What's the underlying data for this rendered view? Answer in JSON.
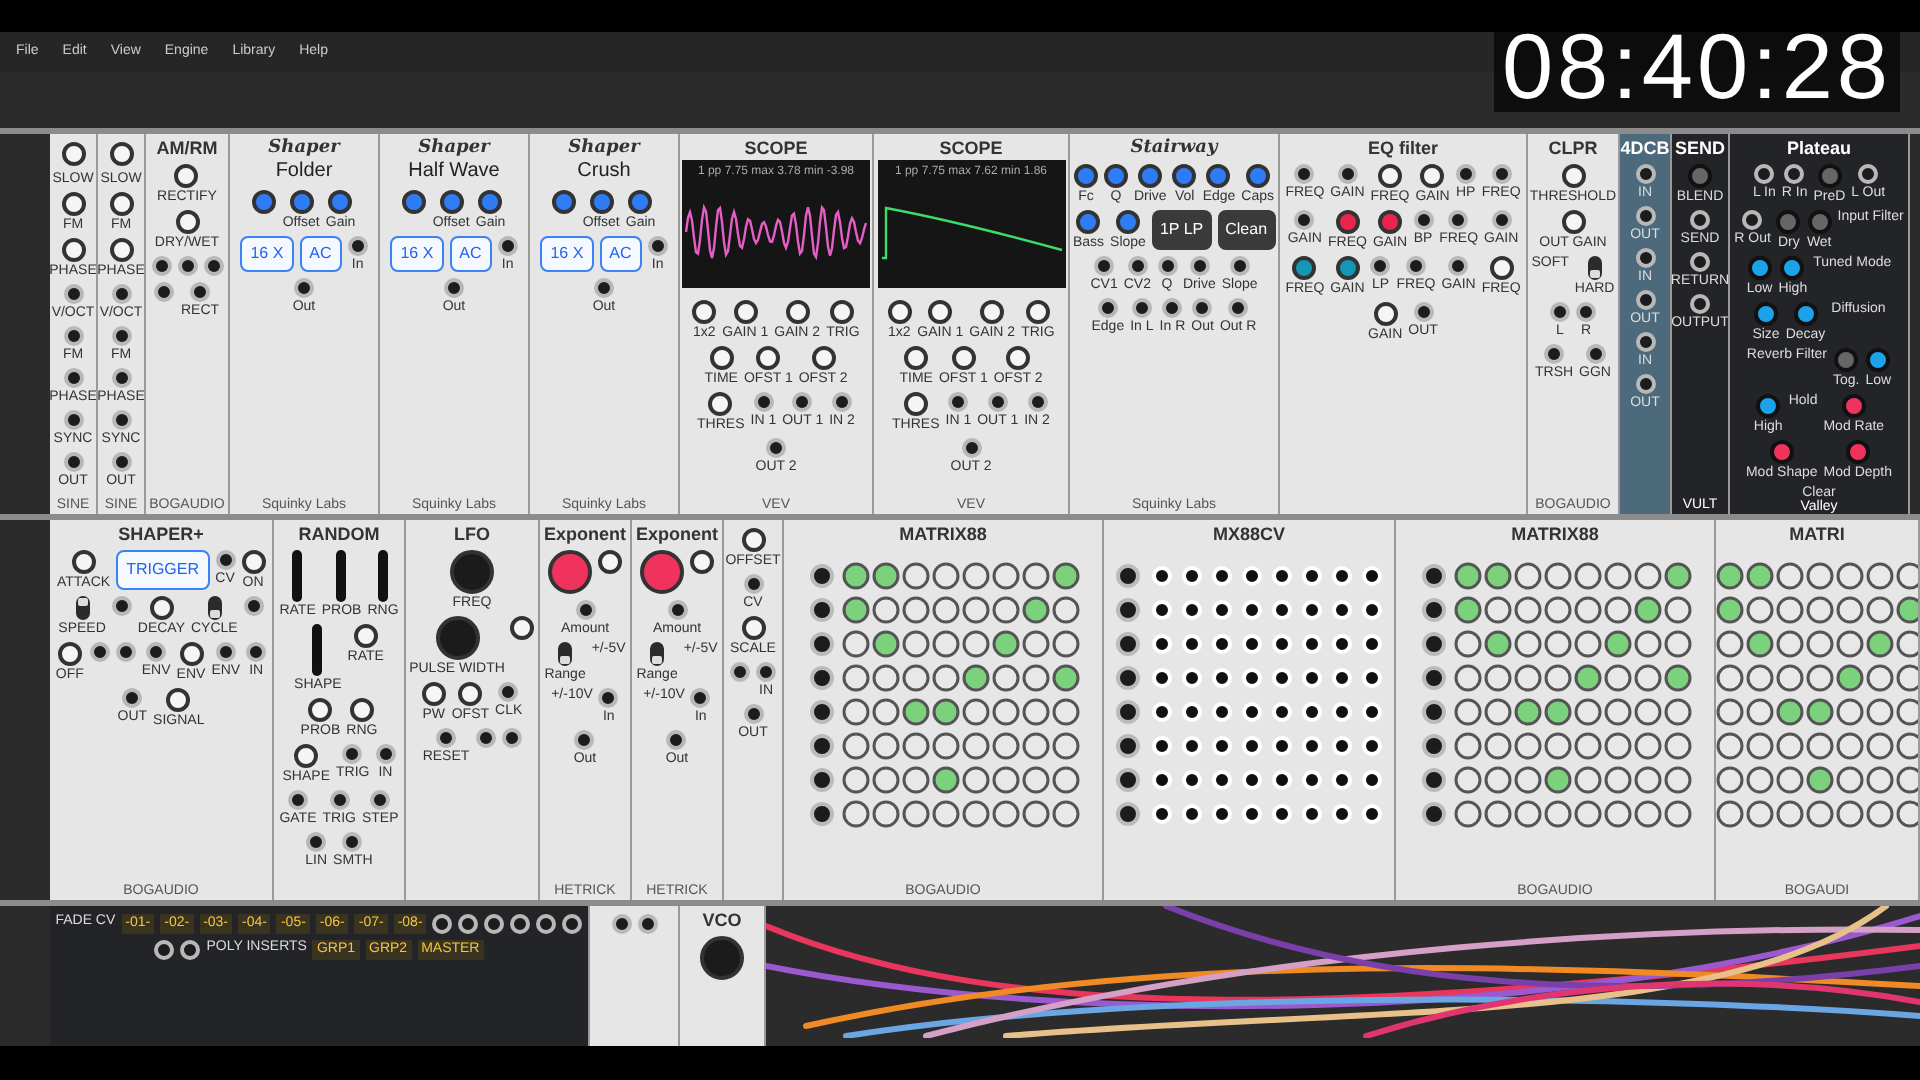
{
  "menu": [
    "File",
    "Edit",
    "View",
    "Engine",
    "Library",
    "Help"
  ],
  "clock": "08:40:28",
  "rows": [
    {
      "modules": [
        {
          "kind": "blank"
        },
        {
          "kind": "light",
          "controls": [
            {
              "kind": "knob"
            },
            {
              "kind": "text",
              "label": "SLOW"
            },
            {
              "kind": "knob",
              "label": "FM"
            },
            {
              "kind": "knob",
              "label": "PHASE"
            },
            {
              "kind": "jack",
              "label": "V/OCT"
            },
            {
              "kind": "jack",
              "label": "FM"
            },
            {
              "kind": "jack",
              "label": "PHASE"
            },
            {
              "kind": "jack",
              "label": "SYNC"
            },
            {
              "kind": "jack",
              "label": "OUT"
            }
          ],
          "footer": "SINE"
        },
        {
          "kind": "light",
          "controls": [
            {
              "kind": "knob"
            },
            {
              "kind": "text",
              "label": "SLOW"
            },
            {
              "kind": "knob",
              "label": "FM"
            },
            {
              "kind": "knob",
              "label": "PHASE"
            },
            {
              "kind": "jack",
              "label": "V/OCT"
            },
            {
              "kind": "jack",
              "label": "FM"
            },
            {
              "kind": "jack",
              "label": "PHASE"
            },
            {
              "kind": "jack",
              "label": "SYNC"
            },
            {
              "kind": "jack",
              "label": "OUT"
            }
          ],
          "footer": "SINE"
        },
        {
          "kind": "light",
          "title": "AM/RM",
          "controls": [
            {
              "kind": "knob",
              "label": "RECTIFY"
            },
            {
              "kind": "knob",
              "label": "DRY/WET"
            },
            {
              "kind": "jack"
            },
            {
              "kind": "jack"
            },
            {
              "kind": "jack"
            },
            {
              "kind": "jack"
            },
            {
              "kind": "jack",
              "label": "RECT"
            }
          ],
          "footer": "BOGAUDIO"
        },
        {
          "kind": "light",
          "title": "Shaper",
          "mode": "Folder",
          "controls": [
            {
              "kind": "knob",
              "color": "#2f7df6"
            },
            {
              "kind": "knob",
              "label": "Offset",
              "color": "#2f7df6"
            },
            {
              "kind": "knob",
              "label": "Gain",
              "color": "#2f7df6"
            },
            {
              "kind": "button",
              "label": "16 X"
            },
            {
              "kind": "button",
              "label": "AC"
            },
            {
              "kind": "jack",
              "label": "In"
            },
            {
              "kind": "jack",
              "label": "Out"
            }
          ],
          "footer": "Squinky Labs"
        },
        {
          "kind": "light",
          "title": "Shaper",
          "mode": "Half Wave",
          "controls": [
            {
              "kind": "knob",
              "color": "#2f7df6"
            },
            {
              "kind": "knob",
              "label": "Offset",
              "color": "#2f7df6"
            },
            {
              "kind": "knob",
              "label": "Gain",
              "color": "#2f7df6"
            },
            {
              "kind": "button",
              "label": "16 X"
            },
            {
              "kind": "button",
              "label": "AC"
            },
            {
              "kind": "jack",
              "label": "In"
            },
            {
              "kind": "jack",
              "label": "Out"
            }
          ],
          "footer": "Squinky Labs"
        },
        {
          "kind": "light",
          "title": "Shaper",
          "mode": "Crush",
          "controls": [
            {
              "kind": "knob",
              "color": "#2f7df6"
            },
            {
              "kind": "knob",
              "label": "Offset",
              "color": "#2f7df6"
            },
            {
              "kind": "knob",
              "label": "Gain",
              "color": "#2f7df6"
            },
            {
              "kind": "button",
              "label": "16 X"
            },
            {
              "kind": "button",
              "label": "AC"
            },
            {
              "kind": "jack",
              "label": "In"
            },
            {
              "kind": "jack",
              "label": "Out"
            }
          ],
          "footer": "Squinky Labs"
        },
        {
          "kind": "light",
          "title": "SCOPE",
          "display": {
            "readout": "1 pp 7.75 max 3.78 min -3.98",
            "kind": "wave"
          },
          "controls": [
            {
              "kind": "knob",
              "label": "1x2"
            },
            {
              "kind": "knob",
              "label": "GAIN 1"
            },
            {
              "kind": "knob",
              "label": "GAIN 2"
            },
            {
              "kind": "knob",
              "label": "TRIG"
            },
            {
              "kind": "knob",
              "label": "TIME"
            },
            {
              "kind": "knob",
              "label": "OFST 1"
            },
            {
              "kind": "knob",
              "label": "OFST 2"
            },
            {
              "kind": "knob",
              "label": "THRES"
            },
            {
              "kind": "jack",
              "label": "IN 1"
            },
            {
              "kind": "jack",
              "label": "OUT 1"
            },
            {
              "kind": "jack",
              "label": "IN 2"
            },
            {
              "kind": "jack",
              "label": "OUT 2"
            }
          ],
          "footer": "VEV"
        },
        {
          "kind": "light",
          "title": "SCOPE",
          "display": {
            "readout": "1 pp 7.75 max 7.62 min 1.86",
            "kind": "ramp"
          },
          "controls": [
            {
              "kind": "knob",
              "label": "1x2"
            },
            {
              "kind": "knob",
              "label": "GAIN 1"
            },
            {
              "kind": "knob",
              "label": "GAIN 2"
            },
            {
              "kind": "knob",
              "label": "TRIG"
            },
            {
              "kind": "knob",
              "label": "TIME"
            },
            {
              "kind": "knob",
              "label": "OFST 1"
            },
            {
              "kind": "knob",
              "label": "OFST 2"
            },
            {
              "kind": "knob",
              "label": "THRES"
            },
            {
              "kind": "jack",
              "label": "IN 1"
            },
            {
              "kind": "jack",
              "label": "OUT 1"
            },
            {
              "kind": "jack",
              "label": "IN 2"
            },
            {
              "kind": "jack",
              "label": "OUT 2"
            }
          ],
          "footer": "VEV"
        },
        {
          "kind": "light",
          "title": "Stairway",
          "controls": [
            {
              "kind": "knob",
              "label": "Fc",
              "color": "#2f7df6"
            },
            {
              "kind": "knob",
              "label": "Q",
              "color": "#2f7df6"
            },
            {
              "kind": "knob",
              "label": "Drive",
              "color": "#2f7df6"
            },
            {
              "kind": "knob",
              "label": "Vol",
              "color": "#2f7df6"
            },
            {
              "kind": "knob",
              "label": "Edge",
              "color": "#2f7df6"
            },
            {
              "kind": "knob",
              "label": "Caps",
              "color": "#2f7df6"
            },
            {
              "kind": "knob",
              "label": "Bass",
              "color": "#2f7df6"
            },
            {
              "kind": "knob",
              "label": "Slope",
              "color": "#2f7df6"
            },
            {
              "kind": "select",
              "label": "1P LP"
            },
            {
              "kind": "select",
              "label": "Clean"
            },
            {
              "kind": "jack",
              "label": "CV1"
            },
            {
              "kind": "jack",
              "label": "CV2"
            },
            {
              "kind": "jack",
              "label": "Q"
            },
            {
              "kind": "jack",
              "label": "Drive"
            },
            {
              "kind": "jack",
              "label": "Slope"
            },
            {
              "kind": "jack",
              "label": "Edge"
            },
            {
              "kind": "jack",
              "label": "In L"
            },
            {
              "kind": "jack",
              "label": "In R"
            },
            {
              "kind": "jack",
              "label": "Out"
            },
            {
              "kind": "jack",
              "label": "Out R"
            }
          ],
          "footer": "Squinky Labs"
        },
        {
          "kind": "light",
          "title": "EQ filter",
          "controls": [
            {
              "kind": "jack",
              "label": "FREQ"
            },
            {
              "kind": "jack",
              "label": "GAIN"
            },
            {
              "kind": "knob",
              "label": "FREQ"
            },
            {
              "kind": "knob",
              "label": "GAIN"
            },
            {
              "kind": "jack",
              "label": "HP"
            },
            {
              "kind": "jack",
              "label": "FREQ"
            },
            {
              "kind": "jack",
              "label": "GAIN"
            },
            {
              "kind": "knob",
              "label": "FREQ",
              "color": "#e8244f"
            },
            {
              "kind": "knob",
              "label": "GAIN",
              "color": "#e8244f"
            },
            {
              "kind": "jack",
              "label": "BP"
            },
            {
              "kind": "jack",
              "label": "FREQ"
            },
            {
              "kind": "jack",
              "label": "GAIN"
            },
            {
              "kind": "knob",
              "label": "FREQ",
              "color": "#1596b5"
            },
            {
              "kind": "knob",
              "label": "GAIN",
              "color": "#1596b5"
            },
            {
              "kind": "jack",
              "label": "LP"
            },
            {
              "kind": "jack",
              "label": "FREQ"
            },
            {
              "kind": "jack",
              "label": "GAIN"
            },
            {
              "kind": "knob",
              "label": "FREQ"
            },
            {
              "kind": "knob",
              "label": "GAIN"
            },
            {
              "kind": "jack",
              "label": "OUT"
            }
          ]
        },
        {
          "kind": "light",
          "title": "CLPR",
          "controls": [
            {
              "kind": "knob",
              "label": "THRESHOLD"
            },
            {
              "kind": "knob",
              "label": "OUT GAIN"
            },
            {
              "kind": "text",
              "label": "SOFT"
            },
            {
              "kind": "switch",
              "label": "HARD",
              "on": false
            },
            {
              "kind": "jack",
              "label": "L"
            },
            {
              "kind": "jack",
              "label": "R"
            },
            {
              "kind": "jack",
              "label": "TRSH"
            },
            {
              "kind": "jack",
              "label": "GGN"
            }
          ],
          "footer": "BOGAUDIO"
        },
        {
          "kind": "steel",
          "title": "4DCB",
          "controls": [
            {
              "kind": "jack",
              "label": "IN"
            },
            {
              "kind": "jack",
              "label": "OUT"
            },
            {
              "kind": "jack",
              "label": "IN"
            },
            {
              "kind": "jack",
              "label": "OUT"
            },
            {
              "kind": "jack",
              "label": "IN"
            },
            {
              "kind": "jack",
              "label": "OUT"
            }
          ]
        },
        {
          "kind": "dark",
          "title": "SEND",
          "controls": [
            {
              "kind": "knob",
              "label": "BLEND"
            },
            {
              "kind": "jack",
              "label": "SEND"
            },
            {
              "kind": "jack",
              "label": "RETURN"
            },
            {
              "kind": "jack",
              "label": "OUTPUT"
            }
          ],
          "footer": "VULT"
        },
        {
          "kind": "dark",
          "title": "Plateau",
          "controls": [
            {
              "kind": "jack",
              "label": "L In"
            },
            {
              "kind": "jack",
              "label": "R In"
            },
            {
              "kind": "knob",
              "label": "PreD"
            },
            {
              "kind": "jack",
              "label": "L Out"
            },
            {
              "kind": "jack",
              "label": "R Out"
            },
            {
              "kind": "knob",
              "label": "Dry"
            },
            {
              "kind": "knob",
              "label": "Wet"
            },
            {
              "kind": "text",
              "label": "Input Filter"
            },
            {
              "kind": "knob",
              "label": "Low",
              "color": "#1aa3e8"
            },
            {
              "kind": "knob",
              "label": "High",
              "color": "#1aa3e8"
            },
            {
              "kind": "text",
              "label": "Tuned Mode"
            },
            {
              "kind": "knob",
              "label": "Size",
              "color": "#1aa3e8"
            },
            {
              "kind": "knob",
              "label": "Decay",
              "color": "#1aa3e8"
            },
            {
              "kind": "text",
              "label": "Diffusion"
            },
            {
              "kind": "text",
              "label": "Reverb Filter"
            },
            {
              "kind": "knob",
              "label": "Tog."
            },
            {
              "kind": "knob",
              "label": "Low",
              "color": "#1aa3e8"
            },
            {
              "kind": "knob",
              "label": "High",
              "color": "#1aa3e8"
            },
            {
              "kind": "text",
              "label": "Hold"
            },
            {
              "kind": "knob",
              "label": "Mod Rate",
              "color": "#f0335c"
            },
            {
              "kind": "knob",
              "label": "Mod Shape",
              "color": "#f0335c"
            },
            {
              "kind": "knob",
              "label": "Mod Depth",
              "color": "#f0335c"
            },
            {
              "kind": "text",
              "label": "Clear"
            }
          ],
          "footer": "Valley"
        },
        {
          "kind": "blank"
        }
      ]
    },
    {
      "modules": [
        {
          "kind": "blank"
        },
        {
          "kind": "light",
          "title": "SHAPER+",
          "controls": [
            {
              "kind": "knob",
              "label": "ATTACK"
            },
            {
              "kind": "button",
              "label": "TRIGGER"
            },
            {
              "kind": "jack",
              "label": "CV"
            },
            {
              "kind": "knob",
              "label": "ON"
            },
            {
              "kind": "switch",
              "label": "SPEED",
              "on": true
            },
            {
              "kind": "jack"
            },
            {
              "kind": "knob",
              "label": "DECAY"
            },
            {
              "kind": "switch",
              "label": "CYCLE",
              "on": false
            },
            {
              "kind": "jack"
            },
            {
              "kind": "knob",
              "label": "OFF"
            },
            {
              "kind": "jack"
            },
            {
              "kind": "jack"
            },
            {
              "kind": "jack",
              "label": "ENV"
            },
            {
              "kind": "knob",
              "label": "ENV"
            },
            {
              "kind": "jack",
              "label": "ENV"
            },
            {
              "kind": "jack",
              "label": "IN"
            },
            {
              "kind": "jack",
              "label": "OUT"
            },
            {
              "kind": "knob",
              "label": "SIGNAL"
            }
          ],
          "footer": "BOGAUDIO"
        },
        {
          "kind": "light",
          "title": "RANDOM",
          "controls": [
            {
              "kind": "slider",
              "label": "RATE"
            },
            {
              "kind": "slider",
              "label": "PROB"
            },
            {
              "kind": "slider",
              "label": "RNG"
            },
            {
              "kind": "slider",
              "label": "SHAPE"
            },
            {
              "kind": "knob",
              "label": "RATE"
            },
            {
              "kind": "knob",
              "label": "PROB"
            },
            {
              "kind": "knob",
              "label": "RNG"
            },
            {
              "kind": "knob",
              "label": "SHAPE"
            },
            {
              "kind": "jack",
              "label": "TRIG"
            },
            {
              "kind": "jack",
              "label": "IN"
            },
            {
              "kind": "jack",
              "label": "GATE"
            },
            {
              "kind": "jack",
              "label": "TRIG"
            },
            {
              "kind": "jack",
              "label": "STEP"
            },
            {
              "kind": "jack",
              "label": "LIN"
            },
            {
              "kind": "jack",
              "label": "SMTH"
            }
          ]
        },
        {
          "kind": "light",
          "title": "LFO",
          "controls": [
            {
              "kind": "bigknob",
              "label": "FREQ"
            },
            {
              "kind": "bigknob",
              "label": "PULSE WIDTH"
            },
            {
              "kind": "knob"
            },
            {
              "kind": "knob",
              "label": "PW"
            },
            {
              "kind": "knob",
              "label": "OFST"
            },
            {
              "kind": "jack",
              "label": "CLK"
            },
            {
              "kind": "jack",
              "label": "RESET"
            },
            {
              "kind": "jack"
            },
            {
              "kind": "jack"
            }
          ]
        },
        {
          "kind": "light",
          "title": "Exponent",
          "controls": [
            {
              "kind": "bigknob",
              "color": "#f0335c"
            },
            {
              "kind": "knob"
            },
            {
              "kind": "jack",
              "label": "Amount"
            },
            {
              "kind": "switch",
              "label": "Range",
              "on": false
            },
            {
              "kind": "text",
              "label": "+/-5V"
            },
            {
              "kind": "text",
              "label": "+/-10V"
            },
            {
              "kind": "jack",
              "label": "In"
            },
            {
              "kind": "jack",
              "label": "Out"
            }
          ],
          "footer": "HETRICK"
        },
        {
          "kind": "light",
          "title": "Exponent",
          "controls": [
            {
              "kind": "bigknob",
              "color": "#f0335c"
            },
            {
              "kind": "knob"
            },
            {
              "kind": "jack",
              "label": "Amount"
            },
            {
              "kind": "switch",
              "label": "Range",
              "on": false
            },
            {
              "kind": "text",
              "label": "+/-5V"
            },
            {
              "kind": "text",
              "label": "+/-10V"
            },
            {
              "kind": "jack",
              "label": "In"
            },
            {
              "kind": "jack",
              "label": "Out"
            }
          ],
          "footer": "HETRICK"
        },
        {
          "kind": "light",
          "controls": [
            {
              "kind": "knob",
              "label": "OFFSET"
            },
            {
              "kind": "jack",
              "label": "CV"
            },
            {
              "kind": "knob",
              "label": "SCALE"
            },
            {
              "kind": "jack"
            },
            {
              "kind": "jack",
              "label": "IN"
            },
            {
              "kind": "jack",
              "label": "OUT"
            }
          ]
        },
        {
          "kind": "light",
          "title": "MATRIX88",
          "grid": {
            "kind": "knobs"
          },
          "footer": "BOGAUDIO"
        },
        {
          "kind": "light",
          "title": "MX88CV",
          "grid": {
            "kind": "dots"
          }
        },
        {
          "kind": "light",
          "title": "MATRIX88",
          "grid": {
            "kind": "knobs"
          },
          "footer": "BOGAUDIO"
        },
        {
          "kind": "light",
          "title": "MATRI",
          "grid": {
            "kind": "knobs"
          },
          "footer": "BOGAUDI"
        }
      ]
    },
    {
      "modules": [
        {
          "kind": "blank"
        },
        {
          "kind": "dark",
          "controls": [
            {
              "kind": "text",
              "label": "FADE CV"
            },
            {
              "kind": "tag",
              "label": "-01-"
            },
            {
              "kind": "tag",
              "label": "-02-"
            },
            {
              "kind": "tag",
              "label": "-03-"
            },
            {
              "kind": "tag",
              "label": "-04-"
            },
            {
              "kind": "tag",
              "label": "-05-"
            },
            {
              "kind": "tag",
              "label": "-06-"
            },
            {
              "kind": "tag",
              "label": "-07-"
            },
            {
              "kind": "tag",
              "label": "-08-"
            },
            {
              "kind": "jack"
            },
            {
              "kind": "jack"
            },
            {
              "kind": "jack"
            },
            {
              "kind": "jack"
            },
            {
              "kind": "jack"
            },
            {
              "kind": "jack"
            },
            {
              "kind": "jack"
            },
            {
              "kind": "jack"
            },
            {
              "kind": "text",
              "label": "POLY INSERTS"
            },
            {
              "kind": "tag",
              "label": "GRP1"
            },
            {
              "kind": "tag",
              "label": "GRP2"
            },
            {
              "kind": "tag",
              "label": "MASTER"
            }
          ]
        },
        {
          "kind": "light",
          "controls": [
            {
              "kind": "jack"
            },
            {
              "kind": "jack"
            }
          ]
        },
        {
          "kind": "light",
          "title": "VCO",
          "controls": [
            {
              "kind": "bigknob"
            }
          ]
        },
        {
          "kind": "blank"
        }
      ]
    }
  ]
}
